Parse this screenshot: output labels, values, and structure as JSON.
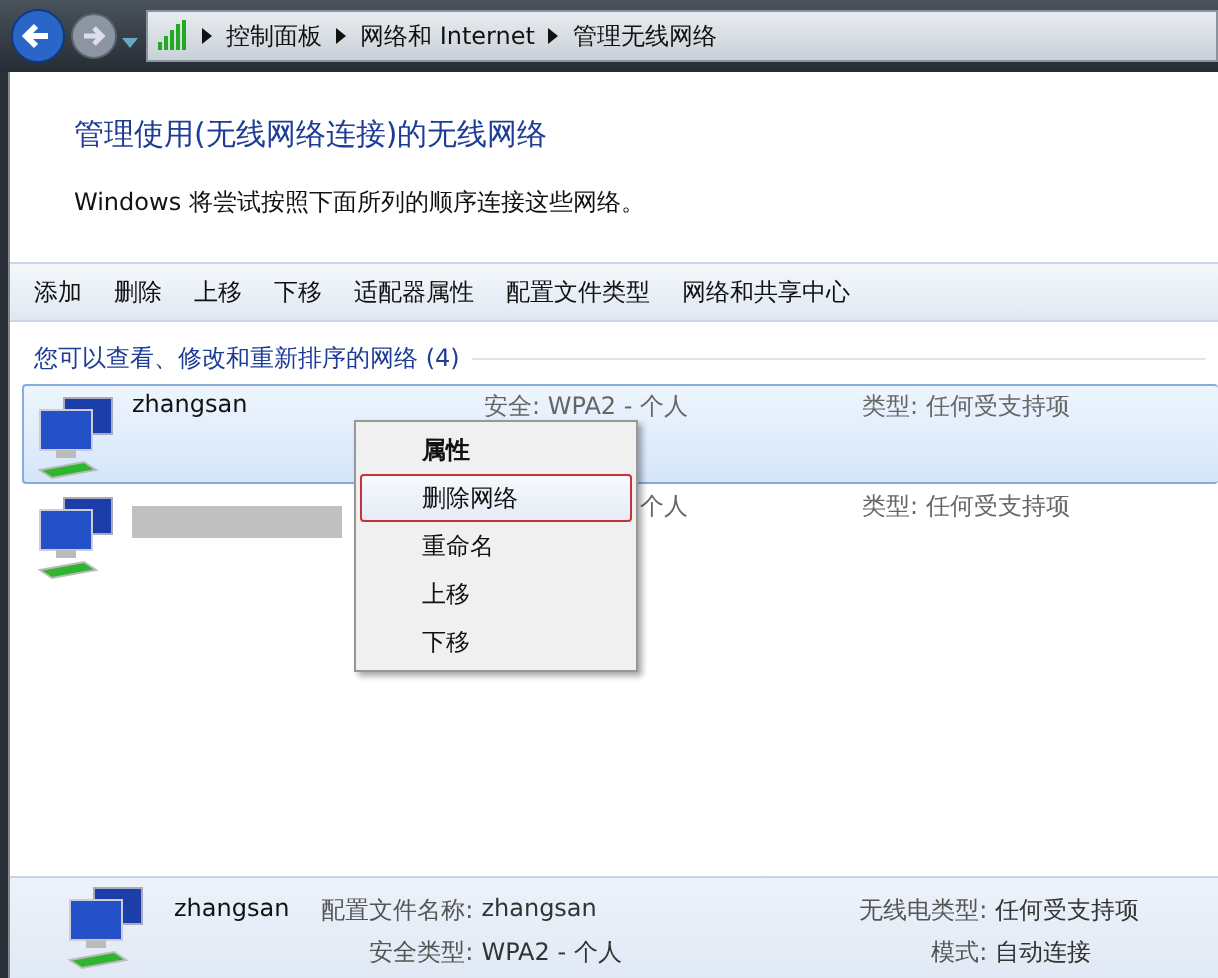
{
  "address_bar": {
    "crumbs": [
      "控制面板",
      "网络和 Internet",
      "管理无线网络"
    ]
  },
  "heading": "管理使用(无线网络连接)的无线网络",
  "description": "Windows 将尝试按照下面所列的顺序连接这些网络。",
  "toolbar": [
    "添加",
    "删除",
    "上移",
    "下移",
    "适配器属性",
    "配置文件类型",
    "网络和共享中心"
  ],
  "group_header": "您可以查看、修改和重新排序的网络 (4)",
  "networks": [
    {
      "name": "zhangsan",
      "redacted": false,
      "security": "安全: WPA2 - 个人",
      "type": "类型: 任何受支持项",
      "selected": true
    },
    {
      "redacted": true,
      "security": "个人",
      "type": "类型: 任何受支持项",
      "selected": false
    }
  ],
  "context_menu": [
    {
      "label": "属性",
      "default": true,
      "selected": false
    },
    {
      "label": "删除网络",
      "default": false,
      "selected": true
    },
    {
      "label": "重命名",
      "default": false,
      "selected": false
    },
    {
      "label": "上移",
      "default": false,
      "selected": false
    },
    {
      "label": "下移",
      "default": false,
      "selected": false
    }
  ],
  "details": {
    "name": "zhangsan",
    "fields": [
      {
        "label": "配置文件名称:",
        "value": "zhangsan"
      },
      {
        "label": "无线电类型:",
        "value": "任何受支持项"
      },
      {
        "label": "安全类型:",
        "value": "WPA2 - 个人"
      },
      {
        "label": "模式:",
        "value": "自动连接"
      }
    ]
  }
}
